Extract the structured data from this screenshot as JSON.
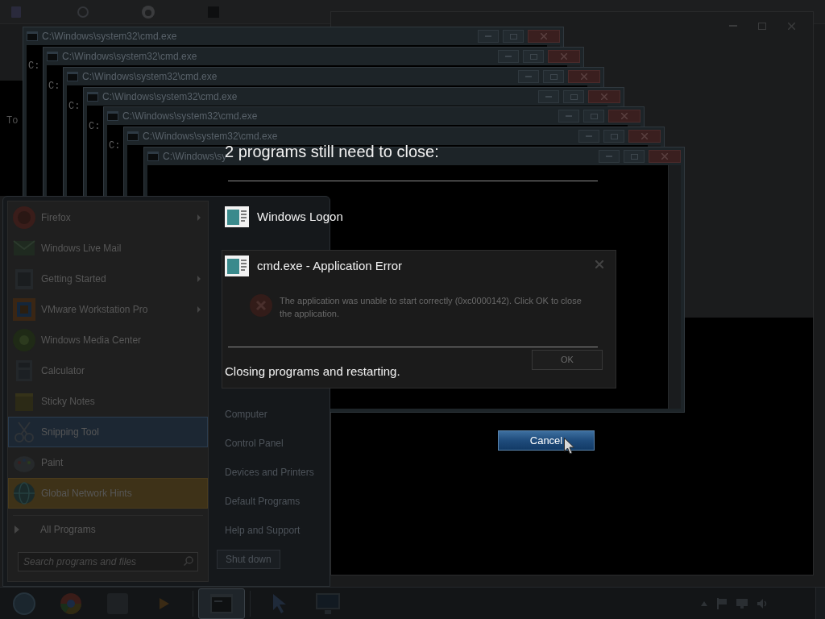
{
  "left_window": {
    "console_text": "To"
  },
  "cmd_windows": [
    {
      "title": "C:\\Windows\\system32\\cmd.exe",
      "prompt": "C:"
    },
    {
      "title": "C:\\Windows\\system32\\cmd.exe",
      "prompt": "C:"
    },
    {
      "title": "C:\\Windows\\system32\\cmd.exe",
      "prompt": "C:"
    },
    {
      "title": "C:\\Windows\\system32\\cmd.exe",
      "prompt": "C:"
    },
    {
      "title": "C:\\Windows\\system32\\cmd.exe",
      "prompt": "C:"
    },
    {
      "title": "C:\\Windows\\system32\\cmd.exe"
    },
    {
      "title": "C:\\Windows\\sy"
    }
  ],
  "restart_screen": {
    "heading": "2 programs still need to close:",
    "programs": [
      {
        "name": "Windows Logon"
      },
      {
        "name": "cmd.exe - Application Error"
      }
    ],
    "status": "Closing programs and restarting.",
    "cancel_button": "Cancel"
  },
  "error_dialog": {
    "message": "The application was unable to start correctly (0xc0000142). Click OK to close the application.",
    "ok_button": "OK"
  },
  "start_menu": {
    "programs": [
      {
        "label": "Firefox",
        "submenu": true,
        "selected": false,
        "highlighted": false
      },
      {
        "label": "Windows Live Mail",
        "submenu": false,
        "selected": false,
        "highlighted": false
      },
      {
        "label": "Getting Started",
        "submenu": true,
        "selected": false,
        "highlighted": false
      },
      {
        "label": "VMware Workstation Pro",
        "submenu": true,
        "selected": false,
        "highlighted": false
      },
      {
        "label": "Windows Media Center",
        "submenu": false,
        "selected": false,
        "highlighted": false
      },
      {
        "label": "Calculator",
        "submenu": false,
        "selected": false,
        "highlighted": false
      },
      {
        "label": "Sticky Notes",
        "submenu": false,
        "selected": false,
        "highlighted": false
      },
      {
        "label": "Snipping Tool",
        "submenu": false,
        "selected": true,
        "highlighted": false
      },
      {
        "label": "Paint",
        "submenu": false,
        "selected": false,
        "highlighted": false
      },
      {
        "label": "Global Network Hints",
        "submenu": false,
        "selected": false,
        "highlighted": true
      }
    ],
    "all_programs": "All Programs",
    "search": {
      "placeholder": "Search programs and files"
    },
    "places": [
      "Computer",
      "Control Panel",
      "Devices and Printers",
      "Default Programs",
      "Help and Support"
    ],
    "shutdown_button": "Shut down"
  },
  "taskbar": {
    "buttons": [
      {
        "selected": false
      },
      {
        "selected": false
      },
      {
        "selected": false
      },
      {
        "selected": false
      },
      {
        "selected": true
      },
      {
        "selected": false
      },
      {
        "selected": false
      }
    ]
  }
}
